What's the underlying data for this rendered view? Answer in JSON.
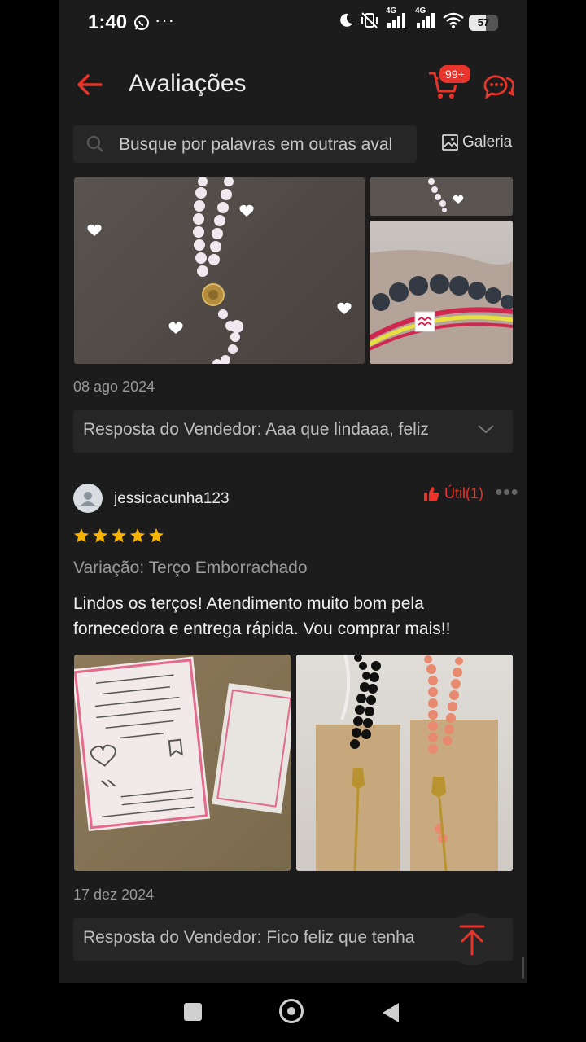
{
  "status_bar": {
    "time": "1:40",
    "more": "···",
    "battery": "57",
    "network_1": "4G",
    "network_2": "4G"
  },
  "header": {
    "title": "Avaliações",
    "cart_badge": "99+"
  },
  "search": {
    "placeholder": "Busque por palavras em outras aval",
    "gallery_label": "Galeria"
  },
  "reviews": [
    {
      "date": "08 ago 2024",
      "seller_reply": "Resposta do Vendedor: Aaa que lindaaa, feliz"
    },
    {
      "username": "jessicacunha123",
      "useful_label": "Útil(1)",
      "rating": 5,
      "variation": "Variação: Terço Emborrachado",
      "text": "Lindos os terços! Atendimento muito bom pela fornecedora e entrega rápida. Vou comprar mais!!",
      "date": "17 dez 2024",
      "seller_reply": "Resposta do Vendedor: Fico feliz que tenha"
    }
  ],
  "colors": {
    "accent": "#e8342a",
    "background": "#1c1c1c",
    "star": "#f6b400"
  }
}
